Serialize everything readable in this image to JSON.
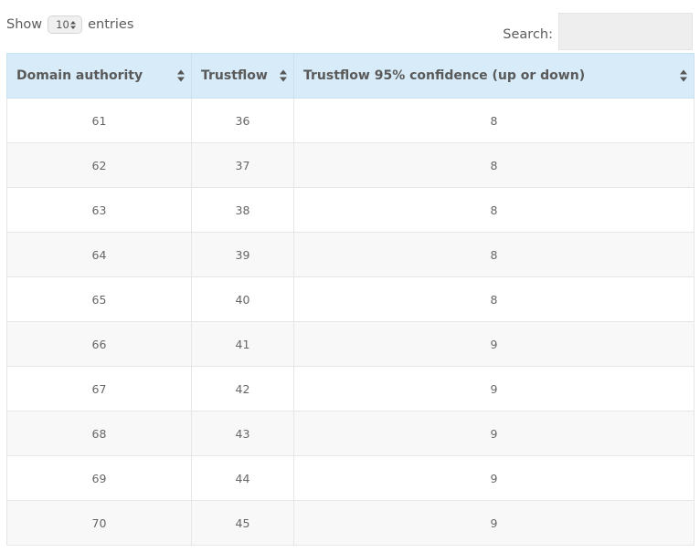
{
  "length_control": {
    "prefix": "Show",
    "selected": "10",
    "suffix": "entries"
  },
  "search": {
    "label": "Search:",
    "value": ""
  },
  "table": {
    "columns": [
      "Domain authority",
      "Trustflow",
      "Trustflow 95% confidence (up or down)"
    ],
    "rows": [
      [
        "61",
        "36",
        "8"
      ],
      [
        "62",
        "37",
        "8"
      ],
      [
        "63",
        "38",
        "8"
      ],
      [
        "64",
        "39",
        "8"
      ],
      [
        "65",
        "40",
        "8"
      ],
      [
        "66",
        "41",
        "9"
      ],
      [
        "67",
        "42",
        "9"
      ],
      [
        "68",
        "43",
        "9"
      ],
      [
        "69",
        "44",
        "9"
      ],
      [
        "70",
        "45",
        "9"
      ]
    ]
  },
  "colors": {
    "header_bg": "#d7ecf8",
    "even_row_bg": "#f8f8f8",
    "text": "#666666"
  },
  "icons": {
    "sort": "sort-both-icon",
    "select_arrows": "select-arrows-icon"
  }
}
